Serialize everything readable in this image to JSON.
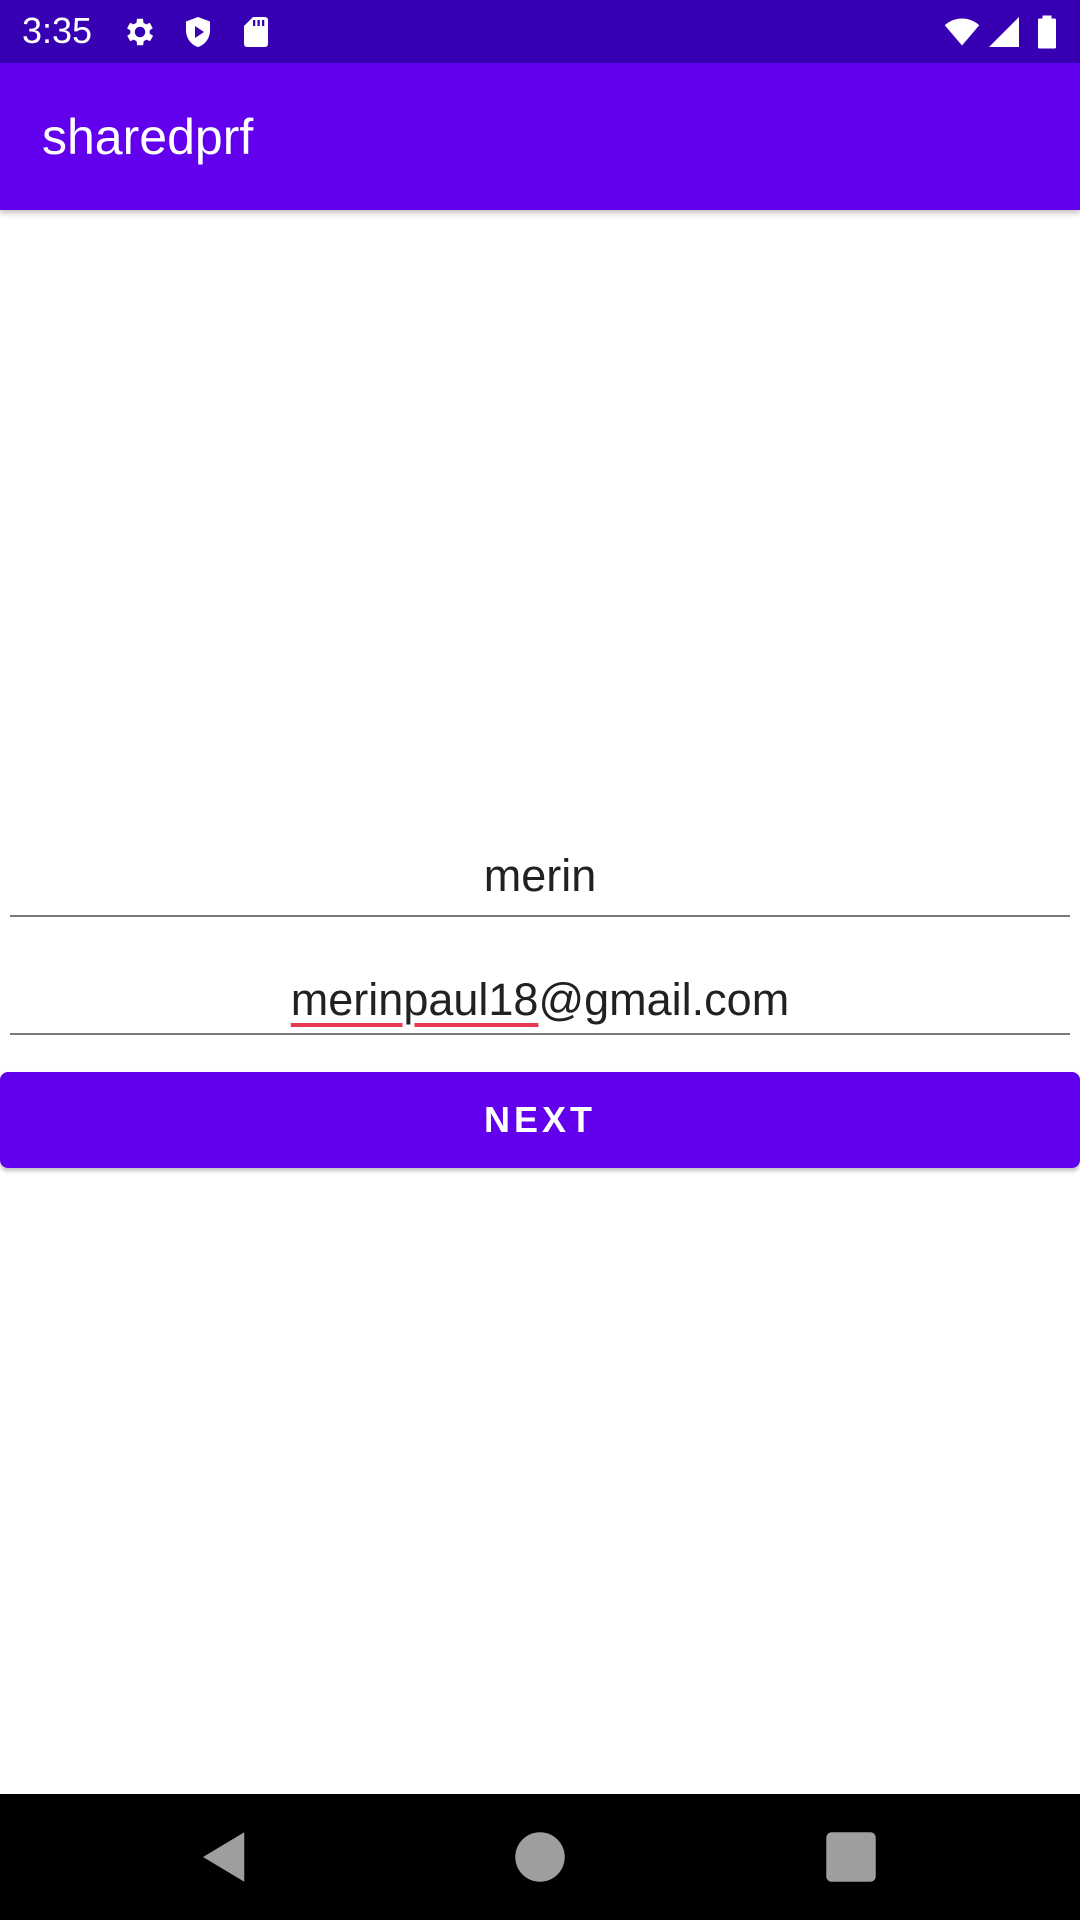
{
  "status_bar": {
    "time": "3:35",
    "icons": [
      "gear-icon",
      "shield-play-icon",
      "sd-card-icon",
      "wifi-icon",
      "signal-icon",
      "battery-icon"
    ]
  },
  "app_bar": {
    "title": "sharedprf"
  },
  "form": {
    "name_value": "merin",
    "email_misspelled_part": "merinpaul18",
    "email_rest": "@gmail.com",
    "next_label": "NEXT"
  },
  "nav_bar": {
    "icons": [
      "back-icon",
      "home-icon",
      "recents-icon"
    ]
  },
  "colors": {
    "status_bar": "#3700b3",
    "primary": "#6200ee",
    "spellcheck_underline": "#e53950"
  }
}
